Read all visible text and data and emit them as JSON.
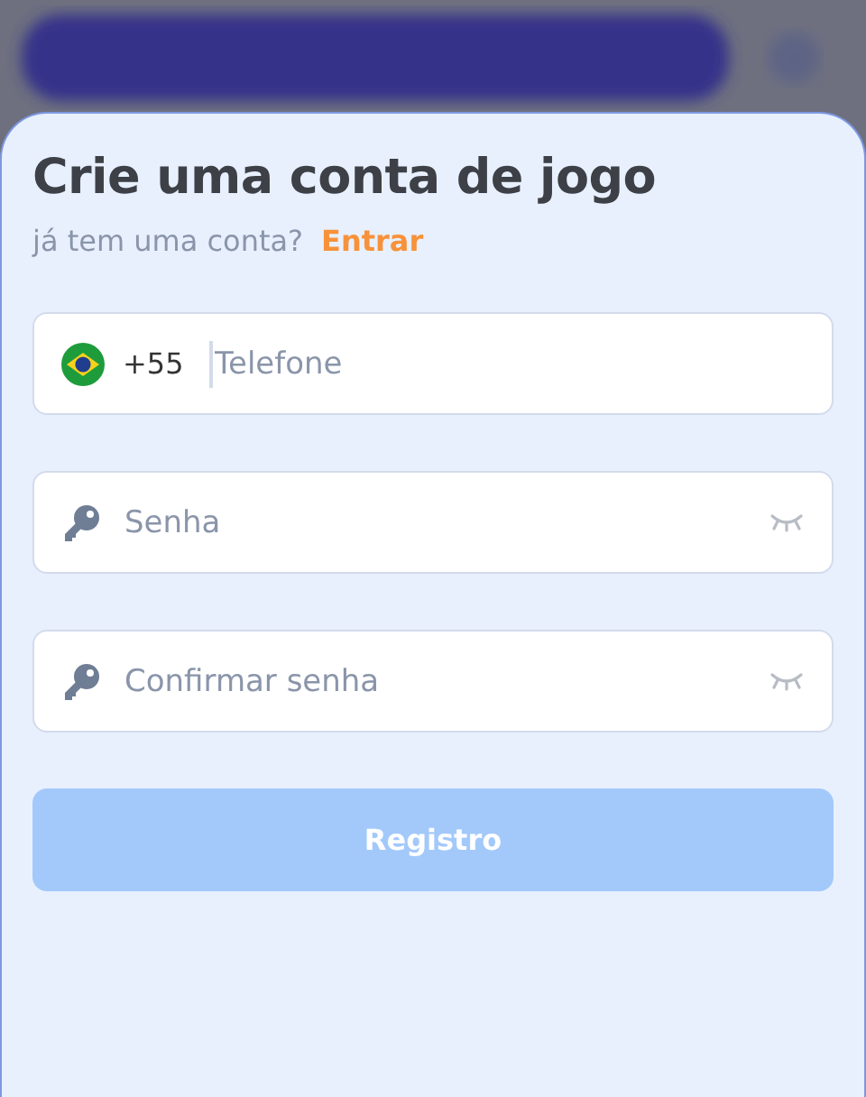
{
  "title": "Crie uma conta de jogo",
  "subtitle": {
    "text": "já tem uma conta?",
    "link": "Entrar"
  },
  "fields": [
    {
      "kind": "phone",
      "prefix": "+55",
      "placeholder": "Telefone"
    },
    {
      "kind": "password",
      "placeholder": "Senha"
    },
    {
      "kind": "password",
      "placeholder": "Confirmar senha"
    }
  ],
  "submit": {
    "label": "Registro",
    "disabled": true
  }
}
